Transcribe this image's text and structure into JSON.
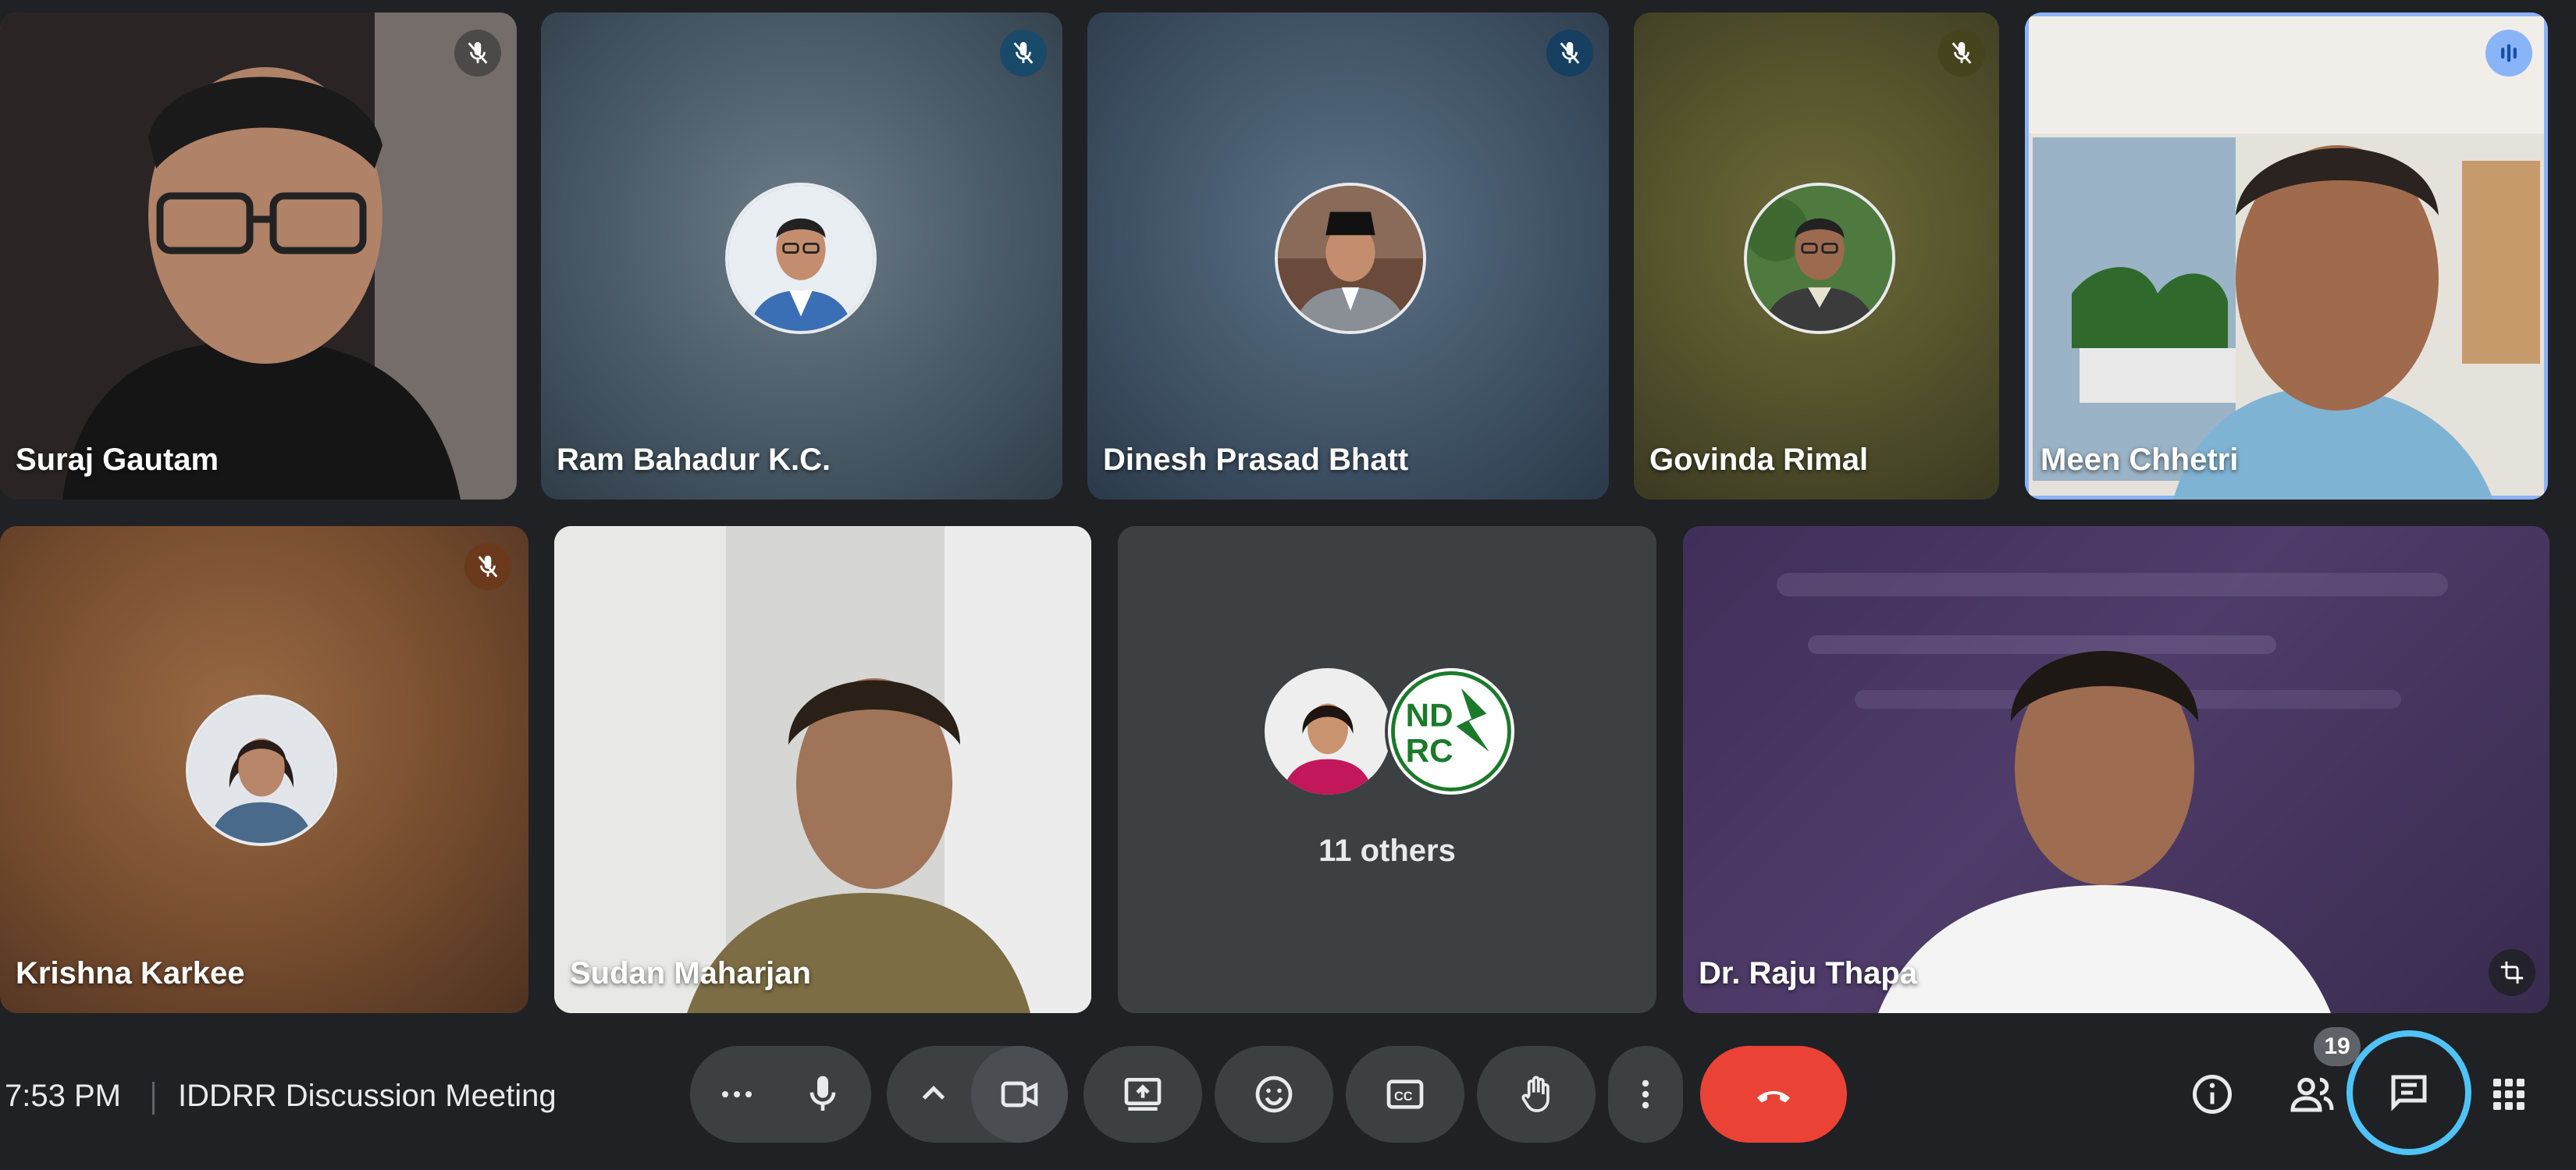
{
  "participants": [
    {
      "name": "Suraj Gautam",
      "muted": true,
      "video": true
    },
    {
      "name": "Ram Bahadur K.C.",
      "muted": true,
      "video": false
    },
    {
      "name": "Dinesh Prasad Bhatt",
      "muted": true,
      "video": false
    },
    {
      "name": "Govinda Rimal",
      "muted": true,
      "video": false
    },
    {
      "name": "Meen Chhetri",
      "muted": false,
      "speaking": true,
      "video": true
    },
    {
      "name": "Krishna Karkee",
      "muted": true,
      "video": false
    },
    {
      "name": "Sudan Maharjan",
      "muted": false,
      "video": true
    },
    {
      "name": "Dr. Raju Thapa",
      "muted": false,
      "video": true
    }
  ],
  "others_tile": {
    "label": "11 others",
    "logo_text": "NDRRC"
  },
  "meeting": {
    "time": "7:53 PM",
    "title": "IDDRR Discussion Meeting"
  },
  "people_count": "19",
  "colors": {
    "accent": "#8ab4f8",
    "end_call": "#ea4335",
    "chat_ring": "#4fc3f7"
  },
  "icons": [
    "mic-off-icon",
    "speaking-icon",
    "more-icon",
    "mic-icon",
    "chevron-up-icon",
    "camera-icon",
    "present-icon",
    "emoji-icon",
    "captions-icon",
    "raise-hand-icon",
    "more-vert-icon",
    "end-call-icon",
    "info-icon",
    "people-icon",
    "chat-icon",
    "apps-icon",
    "crop-icon"
  ]
}
